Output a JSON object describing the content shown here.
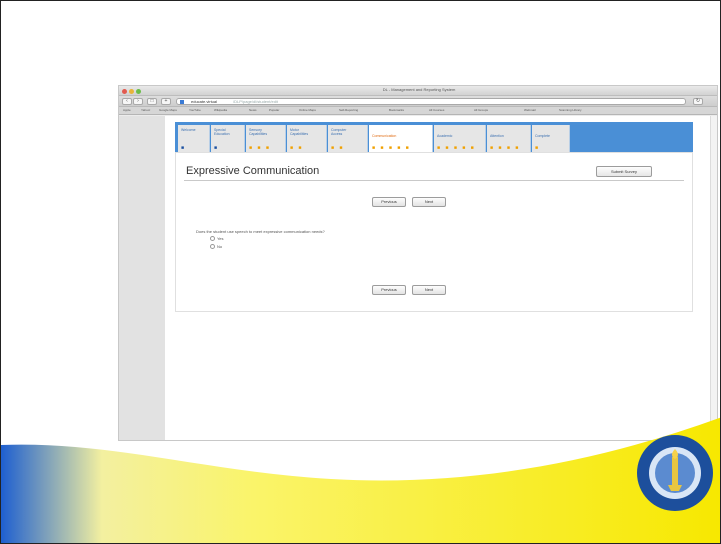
{
  "window": {
    "title": "DL - Management and Reporting System",
    "url_host": "educate.virtual",
    "url_rest": "/DLP/page/dl/student/edit"
  },
  "bookmarks": [
    "Apple",
    "Yahoo!",
    "Google Maps",
    "YouTube",
    "Wikipedia",
    "News",
    "Popular",
    "Online Maps",
    "Self-Reporting",
    "Bookmarks",
    "All Courses",
    "All Groups",
    "Webmail",
    "Scanning Library"
  ],
  "tabs": [
    {
      "label_line1": "Welcome",
      "label_line2": "",
      "dots": "■",
      "dot_color": "blue"
    },
    {
      "label_line1": "Special",
      "label_line2": "Education",
      "dots": "■",
      "dot_color": "blue"
    },
    {
      "label_line1": "Sensory",
      "label_line2": "Capabilities",
      "dots": "■ ■ ■",
      "dot_color": "mixed"
    },
    {
      "label_line1": "Motor",
      "label_line2": "Capabilities",
      "dots": "■ ■",
      "dot_color": "orange"
    },
    {
      "label_line1": "Computer",
      "label_line2": "Access",
      "dots": "■ ■",
      "dot_color": "orange"
    },
    {
      "label_line1": "Communication",
      "label_line2": "",
      "dots": "■ ■ ■ ■ ■",
      "dot_color": "orange",
      "active": true
    },
    {
      "label_line1": "Academic",
      "label_line2": "",
      "dots": "■ ■ ■ ■ ■",
      "dot_color": "orange"
    },
    {
      "label_line1": "Attention",
      "label_line2": "",
      "dots": "■ ■ ■ ■",
      "dot_color": "orange"
    },
    {
      "label_line1": "Complete",
      "label_line2": "",
      "dots": "■",
      "dot_color": "orange"
    }
  ],
  "page": {
    "heading": "Expressive Communication",
    "submit_label": "Submit Survey",
    "previous_label": "Previous",
    "next_label": "Next",
    "question": "Does the student use speech to meet expressive communication needs?",
    "options": [
      "Yes",
      "No"
    ]
  },
  "colors": {
    "tab_strip": "#4a8fd6",
    "active_tab_text": "#e06a10",
    "wave_yellow": "#f7f000",
    "wave_blue": "#1e5fd0"
  }
}
